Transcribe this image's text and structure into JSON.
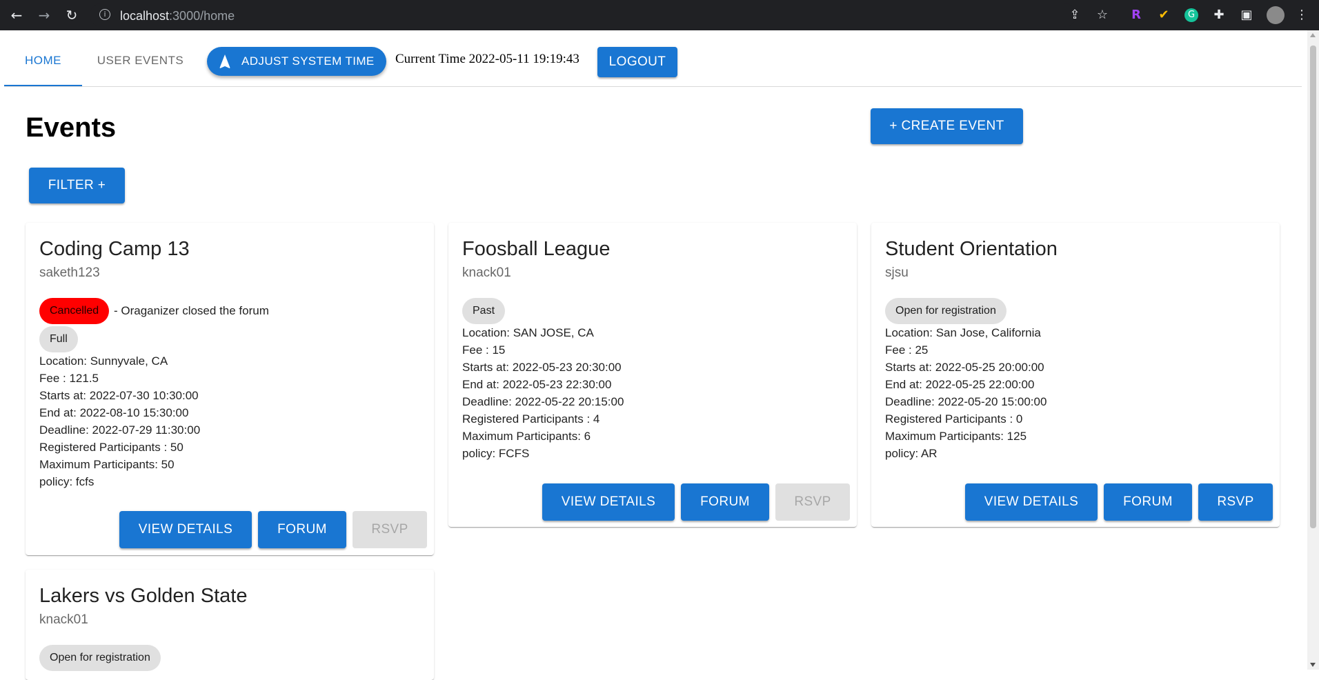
{
  "browser": {
    "url_host": "localhost",
    "url_path": ":3000/home"
  },
  "nav": {
    "tabs": [
      "HOME",
      "USER EVENTS"
    ],
    "adjust_time_label": "ADJUST SYSTEM TIME",
    "current_time": "Current Time 2022-05-11 19:19:43",
    "logout_label": "LOGOUT"
  },
  "page": {
    "title": "Events",
    "create_label": "+ CREATE EVENT",
    "filter_label": "FILTER +"
  },
  "colors": {
    "primary": "#1976d2",
    "cancelled": "#ff0000",
    "chip": "#e0e0e0"
  },
  "events": [
    {
      "title": "Coding Camp 13",
      "owner": "saketh123",
      "status": "Cancelled",
      "status_note": "- Oraganizer closed the forum",
      "capacity_chip": "Full",
      "location": "Location: Sunnyvale, CA",
      "fee": "Fee : 121.5",
      "starts": "Starts at: 2022-07-30 10:30:00",
      "ends": "End at: 2022-08-10 15:30:00",
      "deadline": "Deadline: 2022-07-29 11:30:00",
      "registered": "Registered Participants : 50",
      "maximum": "Maximum Participants: 50",
      "policy": "policy: fcfs",
      "view_label": "VIEW DETAILS",
      "forum_label": "FORUM",
      "rsvp_label": "RSVP",
      "rsvp_enabled": false
    },
    {
      "title": "Foosball League",
      "owner": "knack01",
      "status": "Past",
      "location": "Location: SAN JOSE, CA",
      "fee": "Fee : 15",
      "starts": "Starts at: 2022-05-23 20:30:00",
      "ends": "End at: 2022-05-23 22:30:00",
      "deadline": "Deadline: 2022-05-22 20:15:00",
      "registered": "Registered Participants : 4",
      "maximum": "Maximum Participants: 6",
      "policy": "policy: FCFS",
      "view_label": "VIEW DETAILS",
      "forum_label": "FORUM",
      "rsvp_label": "RSVP",
      "rsvp_enabled": false
    },
    {
      "title": "Student Orientation",
      "owner": "sjsu",
      "status": "Open for registration",
      "location": "Location: San Jose, California",
      "fee": "Fee : 25",
      "starts": "Starts at: 2022-05-25 20:00:00",
      "ends": "End at: 2022-05-25 22:00:00",
      "deadline": "Deadline: 2022-05-20 15:00:00",
      "registered": "Registered Participants : 0",
      "maximum": "Maximum Participants: 125",
      "policy": "policy: AR",
      "view_label": "VIEW DETAILS",
      "forum_label": "FORUM",
      "rsvp_label": "RSVP",
      "rsvp_enabled": true
    },
    {
      "title": "Lakers vs Golden State",
      "owner": "knack01",
      "status": "Open for registration"
    }
  ]
}
